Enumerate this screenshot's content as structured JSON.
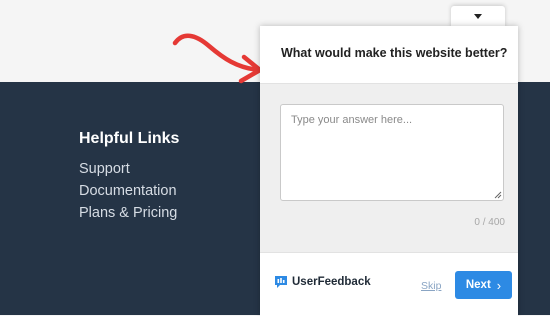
{
  "footer": {
    "title": "Helpful Links",
    "links": [
      "Support",
      "Documentation",
      "Plans & Pricing"
    ]
  },
  "widget": {
    "question": "What would make this website better?",
    "placeholder": "Type your answer here...",
    "counter": "0 / 400",
    "brand": "UserFeedback",
    "skip_label": "Skip",
    "next_label": "Next",
    "next_chevron": "›",
    "toggle_icon": "caret-down-icon"
  },
  "colors": {
    "footer_bg": "#253446",
    "accent": "#2d8ae4",
    "arrow": "#e53935"
  }
}
